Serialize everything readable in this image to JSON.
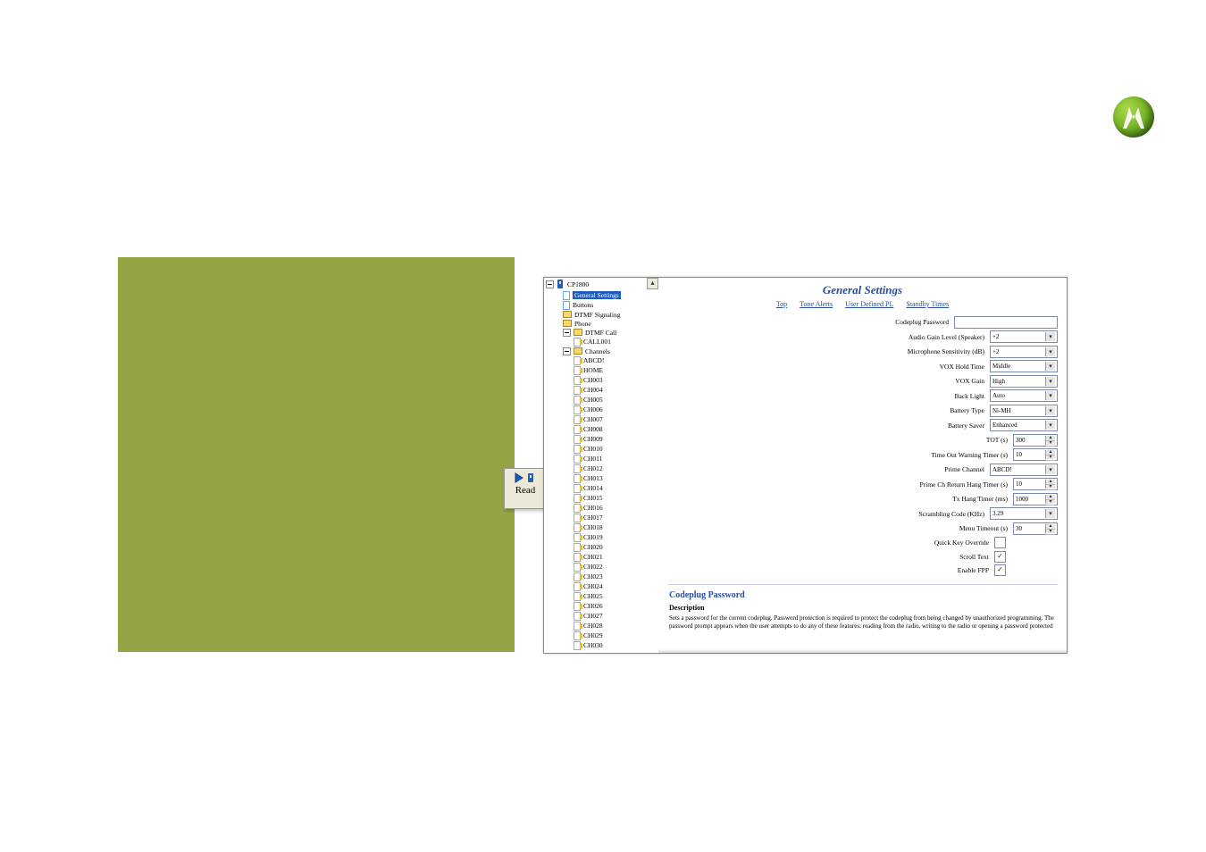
{
  "logo": {
    "name": "motorola-batwing-logo"
  },
  "readbox": {
    "label": "Read"
  },
  "tree": {
    "root": "CP1800",
    "nodes": [
      {
        "icon": "doc",
        "label": "General Settings",
        "selected": true,
        "indent": 14
      },
      {
        "icon": "doc",
        "label": "Buttons",
        "indent": 14
      },
      {
        "icon": "fold",
        "label": "DTMF Signaling",
        "indent": 14
      },
      {
        "icon": "fold",
        "label": "Phone",
        "indent": 14
      },
      {
        "icon": "fold",
        "label": "DTMF Call",
        "indent": 14,
        "expander": true
      },
      {
        "icon": "pg",
        "label": "CALL001",
        "indent": 26
      },
      {
        "icon": "fold",
        "label": "Channels",
        "indent": 14,
        "expander": true
      },
      {
        "icon": "pg",
        "label": "ABCD!",
        "indent": 26
      },
      {
        "icon": "pg",
        "label": "HOME",
        "indent": 26
      },
      {
        "icon": "pg",
        "label": "CH003",
        "indent": 26
      },
      {
        "icon": "pg",
        "label": "CH004",
        "indent": 26
      },
      {
        "icon": "pg",
        "label": "CH005",
        "indent": 26
      },
      {
        "icon": "pg",
        "label": "CH006",
        "indent": 26
      },
      {
        "icon": "pg",
        "label": "CH007",
        "indent": 26
      },
      {
        "icon": "pg",
        "label": "CH008",
        "indent": 26
      },
      {
        "icon": "pg",
        "label": "CH009",
        "indent": 26
      },
      {
        "icon": "pg",
        "label": "CH010",
        "indent": 26
      },
      {
        "icon": "pg",
        "label": "CH011",
        "indent": 26
      },
      {
        "icon": "pg",
        "label": "CH012",
        "indent": 26
      },
      {
        "icon": "pg",
        "label": "CH013",
        "indent": 26
      },
      {
        "icon": "pg",
        "label": "CH014",
        "indent": 26
      },
      {
        "icon": "pg",
        "label": "CH015",
        "indent": 26
      },
      {
        "icon": "pg",
        "label": "CH016",
        "indent": 26
      },
      {
        "icon": "pg",
        "label": "CH017",
        "indent": 26
      },
      {
        "icon": "pg",
        "label": "CH018",
        "indent": 26
      },
      {
        "icon": "pg",
        "label": "CH019",
        "indent": 26
      },
      {
        "icon": "pg",
        "label": "CH020",
        "indent": 26
      },
      {
        "icon": "pg",
        "label": "CH021",
        "indent": 26
      },
      {
        "icon": "pg",
        "label": "CH022",
        "indent": 26
      },
      {
        "icon": "pg",
        "label": "CH023",
        "indent": 26
      },
      {
        "icon": "pg",
        "label": "CH024",
        "indent": 26
      },
      {
        "icon": "pg",
        "label": "CH025",
        "indent": 26
      },
      {
        "icon": "pg",
        "label": "CH026",
        "indent": 26
      },
      {
        "icon": "pg",
        "label": "CH027",
        "indent": 26
      },
      {
        "icon": "pg",
        "label": "CH028",
        "indent": 26
      },
      {
        "icon": "pg",
        "label": "CH029",
        "indent": 26
      },
      {
        "icon": "pg",
        "label": "CH030",
        "indent": 26
      }
    ]
  },
  "panel": {
    "title": "General Settings",
    "tabs": [
      "Top",
      "Tone Alerts",
      "User Defined PL",
      "Standby Times"
    ],
    "rows": [
      {
        "label": "Codeplug Password",
        "type": "text",
        "value": ""
      },
      {
        "label": "Audio Gain Level (Speaker)",
        "type": "dropdown",
        "value": "+2"
      },
      {
        "label": "Microphone Sensitivity (dB)",
        "type": "dropdown",
        "value": "+2"
      },
      {
        "label": "VOX Hold Time",
        "type": "dropdown",
        "value": "Middle"
      },
      {
        "label": "VOX Gain",
        "type": "dropdown",
        "value": "High"
      },
      {
        "label": "Back Light",
        "type": "dropdown",
        "value": "Auto"
      },
      {
        "label": "Battery Type",
        "type": "dropdown",
        "value": "Ni-MH"
      },
      {
        "label": "Battery Saver",
        "type": "dropdown",
        "value": "Enhanced"
      },
      {
        "label": "TOT (s)",
        "type": "spinner",
        "value": "300"
      },
      {
        "label": "Time Out Warning Timer (s)",
        "type": "spinner",
        "value": "10"
      },
      {
        "label": "Prime Channel",
        "type": "dropdown",
        "value": "ABCD!"
      },
      {
        "label": "Prime Ch Return Hang Timer (s)",
        "type": "spinner",
        "value": "10"
      },
      {
        "label": "Tx Hang Timer (ms)",
        "type": "spinner",
        "value": "1000"
      },
      {
        "label": "Scrambling Code (KHz)",
        "type": "dropdown",
        "value": "3.29"
      },
      {
        "label": "Menu Timeout (s)",
        "type": "spinner",
        "value": "30"
      },
      {
        "label": "Quick Key Override",
        "type": "checkbox",
        "value": ""
      },
      {
        "label": "Scroll Text",
        "type": "checkbox",
        "value": "✓"
      },
      {
        "label": "Enable FPP",
        "type": "checkbox",
        "value": "✓"
      }
    ],
    "help": {
      "heading": "Codeplug Password",
      "subheading": "Description",
      "body": "Sets a password for the current codeplug. Password protection is required to protect the codeplug from being changed by unauthorized programming. The password prompt appears when the user attempts to do any of these features: reading from the radio, writing to the radio or opening a password protected"
    }
  }
}
